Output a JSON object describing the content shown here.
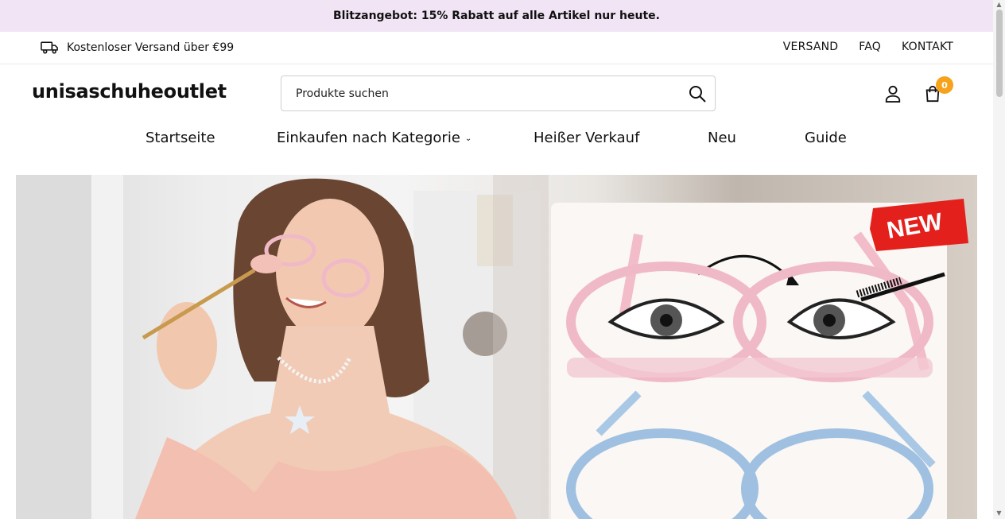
{
  "announcement": {
    "text": "Blitzangebot: 15% Rabatt auf alle Artikel nur heute."
  },
  "topbar": {
    "shipping_text": "Kostenloser Versand über €99",
    "links": [
      "VERSAND",
      "FAQ",
      "KONTAKT"
    ]
  },
  "header": {
    "logo": "unisaschuheoutlet",
    "search_placeholder": "Produkte suchen",
    "cart_count": "0"
  },
  "nav": {
    "items": [
      "Startseite",
      "Einkaufen nach Kategorie",
      "Heißer Verkauf",
      "Neu",
      "Guide"
    ]
  },
  "hero": {
    "badge_text": "NEW",
    "colors": {
      "badge": "#e3201b",
      "accent_pink": "#f0b9c7",
      "accent_blue": "#9fc0e0"
    }
  },
  "colors": {
    "announcement_bg": "#f1e4f5",
    "cart_badge": "#f7a21b"
  }
}
